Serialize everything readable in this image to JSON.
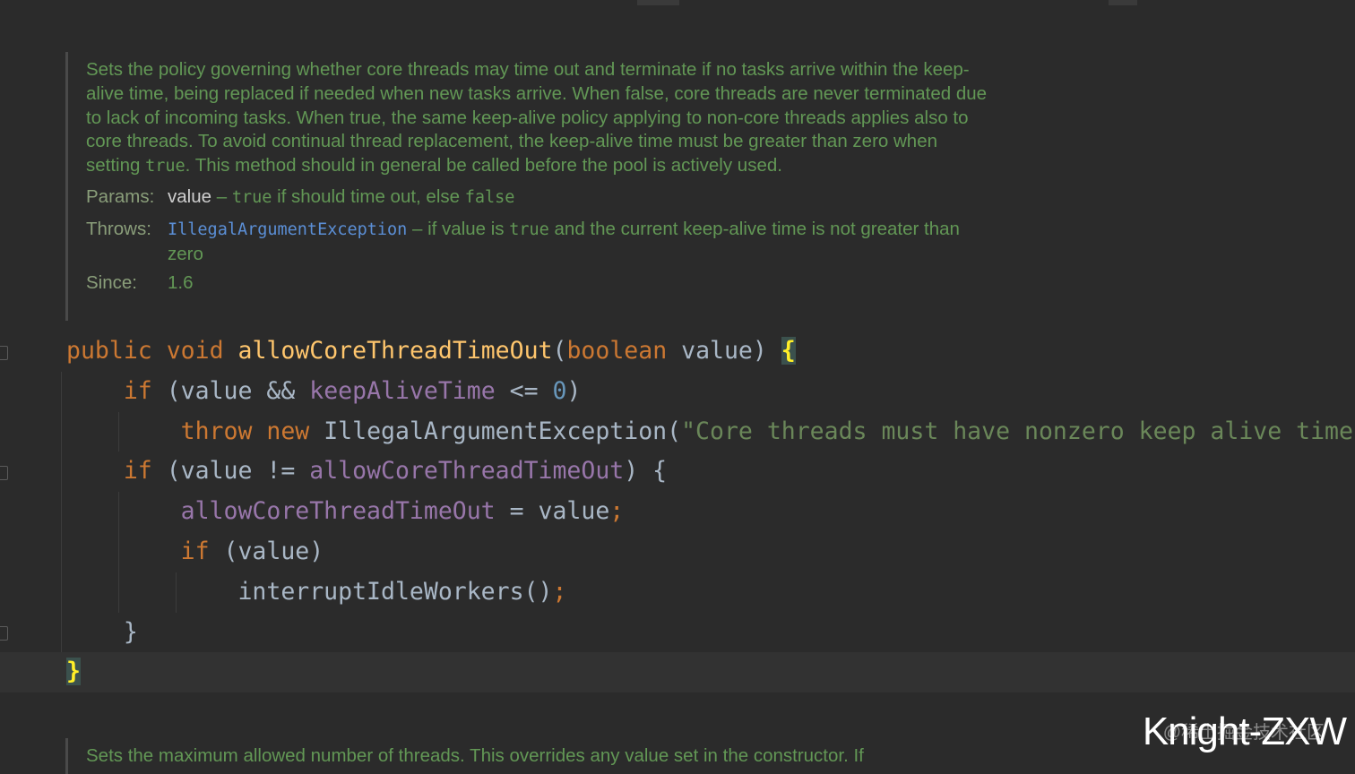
{
  "doc": {
    "description_parts": [
      "Sets the policy governing whether core threads may time out and terminate if no tasks arrive within the keep-alive time, being replaced if needed when new tasks arrive. When false, core threads are never terminated due to lack of incoming tasks. When true, the same keep-alive policy applying to non-core threads applies also to core threads. To avoid continual thread replacement, the keep-alive time must be greater than zero when setting ",
      "true",
      ". This method should in general be called before the pool is actively used."
    ],
    "params_label": "Params:",
    "param_name": "value",
    "param_dash": " – ",
    "param_true": "true",
    "param_mid": " if should time out, else ",
    "param_false": "false",
    "throws_label": "Throws:",
    "throws_exception": "IllegalArgumentException",
    "throws_part1": " – if value is ",
    "throws_true": "true",
    "throws_part2": " and the current keep-alive time is not greater than zero",
    "since_label": "Since:",
    "since_value": "1.6"
  },
  "code": {
    "l1_public": "public",
    "l1_void": "void",
    "l1_method": "allowCoreThreadTimeOut",
    "l1_open": "(",
    "l1_boolean": "boolean",
    "l1_param": " value) ",
    "l1_brace": "{",
    "l2_if": "if",
    "l2_cond": " (value && ",
    "l2_field": "keepAliveTime",
    "l2_op": " <= ",
    "l2_zero": "0",
    "l2_close": ")",
    "l3_throw": "throw",
    "l3_new": "new",
    "l3_class": " IllegalArgumentException(",
    "l3_string": "\"Core threads must have nonzero keep alive times\"",
    "l4_if": "if",
    "l4_cond": " (value != ",
    "l4_field": "allowCoreThreadTimeOut",
    "l4_close": ") {",
    "l5_field": "allowCoreThreadTimeOut",
    "l5_assign": " = value",
    "l5_semi": ";",
    "l6_if": "if",
    "l6_cond": " (value)",
    "l7_call": "interruptIdleWorkers()",
    "l7_semi": ";",
    "l8_brace": "}",
    "l9_brace": "}"
  },
  "next_doc": {
    "text": "Sets the maximum allowed number of threads. This overrides any value set in the constructor. If"
  },
  "watermark": {
    "main": "Knight-ZXW",
    "sub": "@稀土掘金技术社区"
  }
}
